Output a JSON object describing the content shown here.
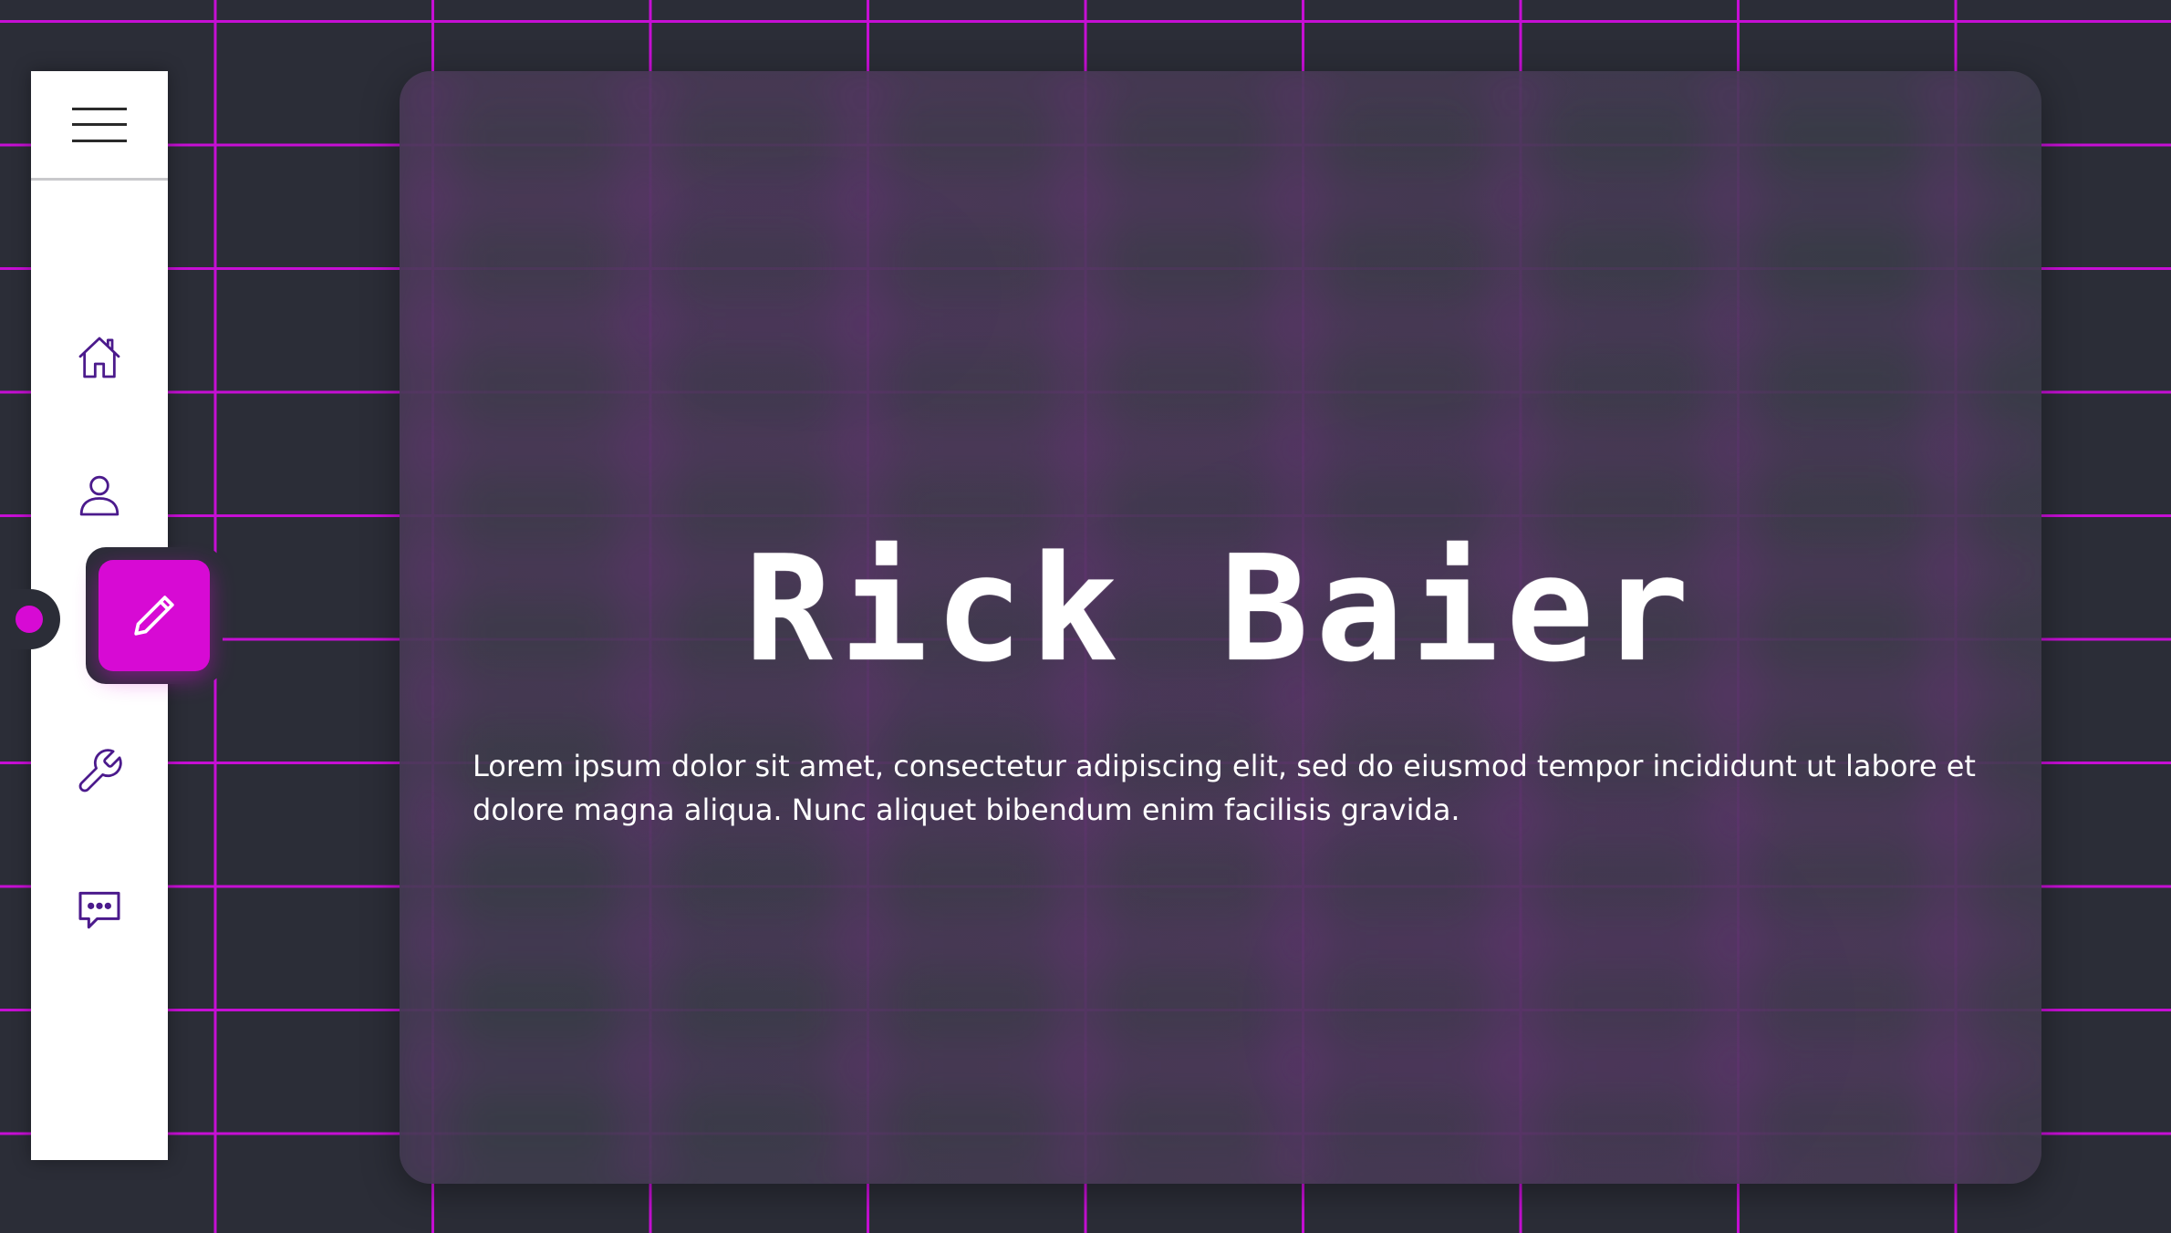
{
  "sidebar": {
    "menu_icon": "hamburger-menu-icon",
    "items": [
      {
        "id": "home",
        "icon": "home-icon",
        "active": false
      },
      {
        "id": "profile",
        "icon": "user-icon",
        "active": false
      },
      {
        "id": "edit",
        "icon": "pencil-icon",
        "active": true
      },
      {
        "id": "tools",
        "icon": "wrench-icon",
        "active": false
      },
      {
        "id": "chat",
        "icon": "chat-bubble-icon",
        "active": false
      }
    ]
  },
  "hero": {
    "title": "Rick Baier",
    "text": "Lorem ipsum dolor sit amet, consectetur adipiscing elit, sed do eiusmod tempor incididunt ut labore et dolore magna aliqua. Nunc aliquet bibendum enim facilisis gravida."
  },
  "colors": {
    "accent": "#d70ad4",
    "grid": "#c60fd4",
    "background": "#2b2d37",
    "icon": "#4b1a8c",
    "sidebar": "#ffffff"
  }
}
